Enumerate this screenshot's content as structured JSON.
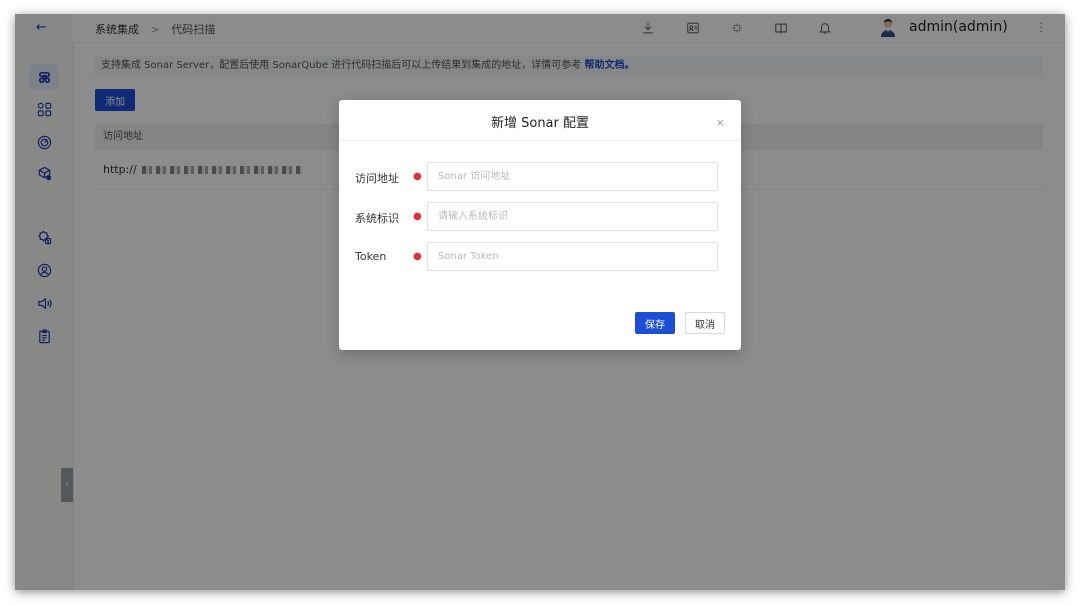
{
  "sidebar": {
    "back_icon": "arrow-left-icon",
    "items": [
      {
        "icon": "command-icon",
        "active": true
      },
      {
        "icon": "apps-grid-icon"
      },
      {
        "icon": "target-icon"
      },
      {
        "icon": "package-settings-icon"
      },
      {
        "icon": "settings-shield-icon"
      },
      {
        "icon": "user-circle-icon"
      },
      {
        "icon": "speaker-icon"
      },
      {
        "icon": "clipboard-icon"
      }
    ],
    "collapse_icon": "chevron-right-icon"
  },
  "header": {
    "breadcrumb": [
      "系统集成",
      "代码扫描"
    ],
    "breadcrumb_separator": ">",
    "icons": [
      "download-icon",
      "contact-card-icon",
      "sparkle-icon",
      "book-icon",
      "bell-icon"
    ],
    "username": "admin(admin)",
    "more_icon": "more-vertical-icon"
  },
  "main": {
    "info_text": "支持集成 Sonar Server，配置后使用 SonarQube 进行代码扫描后可以上传结果到集成的地址，详情可参考",
    "info_link": "帮助文档。",
    "add_button": "添加",
    "table": {
      "columns": [
        "访问地址"
      ],
      "rows": [
        {
          "address": "http://"
        }
      ]
    }
  },
  "modal": {
    "title": "新增 Sonar 配置",
    "close_icon": "close-icon",
    "fields": [
      {
        "label": "访问地址",
        "placeholder": "Sonar 访问地址",
        "required": true
      },
      {
        "label": "系统标识",
        "placeholder": "请输入系统标识",
        "required": true
      },
      {
        "label": "Token",
        "placeholder": "Sonar Token",
        "required": true
      }
    ],
    "save": "保存",
    "cancel": "取消"
  },
  "colors": {
    "accent": "#1c4fd6",
    "required": "#e0303a",
    "overlay": "rgba(0,0,0,0.45)"
  }
}
